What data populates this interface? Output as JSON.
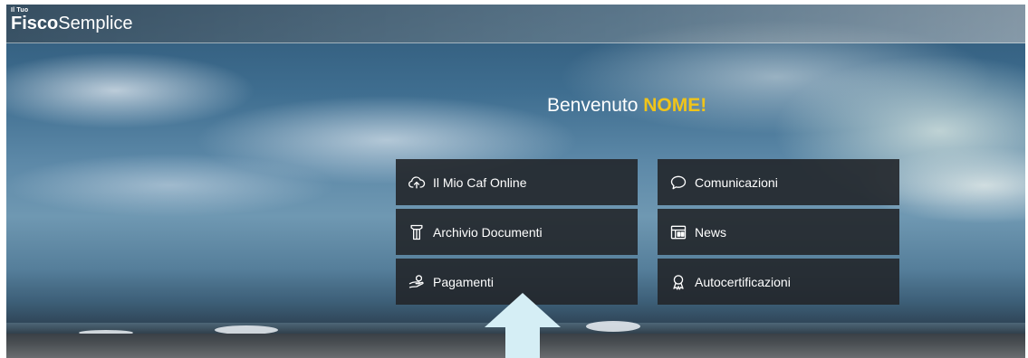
{
  "header": {
    "logo_small": "Il Tuo",
    "logo_bold": "Fisco",
    "logo_light": "Semplice"
  },
  "welcome": {
    "text": "Benvenuto ",
    "name": "NOME!"
  },
  "tiles": [
    {
      "label": "Il Mio Caf Online",
      "icon": "cloud-upload-icon"
    },
    {
      "label": "Comunicazioni",
      "icon": "speech-bubble-icon"
    },
    {
      "label": "Archivio Documenti",
      "icon": "archive-icon"
    },
    {
      "label": "News",
      "icon": "newspaper-icon"
    },
    {
      "label": "Pagamenti",
      "icon": "payment-hand-icon"
    },
    {
      "label": "Autocertificazioni",
      "icon": "award-ribbon-icon"
    }
  ],
  "colors": {
    "accent_name": "#f0c419",
    "tile_bg": "#22262a",
    "arrow": "#d5eef5"
  }
}
